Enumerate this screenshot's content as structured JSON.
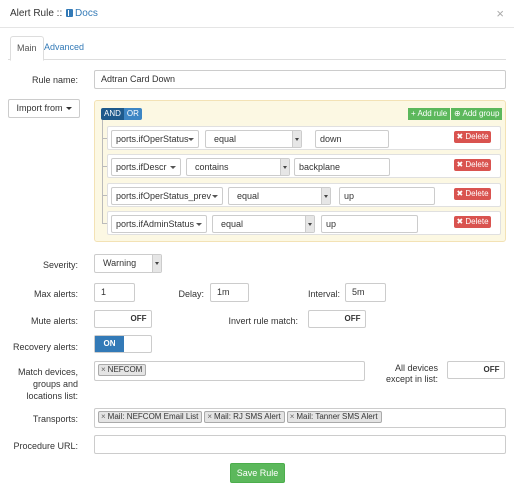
{
  "header": {
    "title_prefix": "Alert Rule :: ",
    "docs_label": "Docs",
    "close_glyph": "×"
  },
  "tabs": [
    "Main",
    "Advanced"
  ],
  "form": {
    "rule_name_label": "Rule name:",
    "rule_name_value": "Adtran Card Down",
    "import_label": "Import from",
    "severity_label": "Severity:",
    "severity_value": "Warning",
    "max_alerts_label": "Max alerts:",
    "max_alerts_value": "1",
    "delay_label": "Delay:",
    "delay_value": "1m",
    "interval_label": "Interval:",
    "interval_value": "5m",
    "mute_label": "Mute alerts:",
    "mute_state": "OFF",
    "invert_label": "Invert rule match:",
    "invert_state": "OFF",
    "recovery_label": "Recovery alerts:",
    "recovery_state": "ON",
    "match_label": "Match devices, groups and locations list:",
    "match_tags": [
      "NEFCOM"
    ],
    "all_devices_label": "All devices except in list:",
    "all_devices_state": "OFF",
    "transports_label": "Transports:",
    "transport_tags": [
      "Mail: NEFCOM Email List",
      "Mail: RJ SMS Alert",
      "Mail: Tanner SMS Alert"
    ],
    "procedure_label": "Procedure URL:",
    "procedure_value": "",
    "save_label": "Save Rule"
  },
  "builder": {
    "and_label": "AND",
    "or_label": "OR",
    "add_rule_label": "Add rule",
    "add_group_label": "Add group",
    "delete_label": "Delete",
    "rules": [
      {
        "field": "ports.ifOperStatus",
        "operator": "equal",
        "value": "down"
      },
      {
        "field": "ports.ifDescr",
        "operator": "contains",
        "value": "backplane"
      },
      {
        "field": "ports.ifOperStatus_prev",
        "operator": "equal",
        "value": "up"
      },
      {
        "field": "ports.ifAdminStatus",
        "operator": "equal",
        "value": "up"
      }
    ]
  },
  "colors": {
    "primary": "#337ab7",
    "success": "#5cb85c",
    "danger": "#d9534f",
    "builder_bg": "#fcf8e3"
  }
}
